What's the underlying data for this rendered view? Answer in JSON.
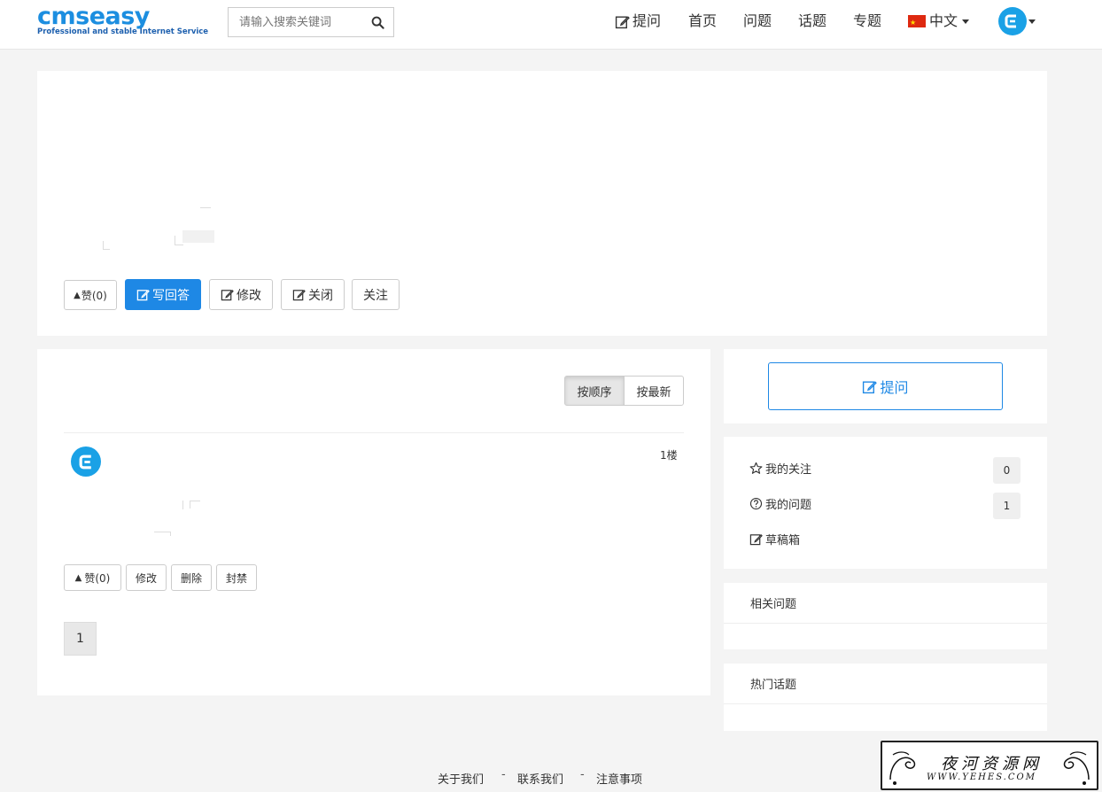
{
  "header": {
    "logo_text": "cmseasy",
    "logo_tagline": "Professional and stable Internet Service",
    "search_placeholder": "请输入搜索关键词",
    "nav": {
      "ask": "提问",
      "home": "首页",
      "questions": "问题",
      "topics": "话题",
      "specials": "专题",
      "language": "中文"
    }
  },
  "question": {
    "like_label": "赞(0)",
    "write_answer_label": "写回答",
    "edit_label": "修改",
    "close_label": "关闭",
    "follow_label": "关注"
  },
  "answers": {
    "sort_order_label": "按顺序",
    "sort_newest_label": "按最新",
    "floor_label": "1楼",
    "like_label": "赞(0)",
    "edit_label": "修改",
    "delete_label": "删除",
    "ban_label": "封禁",
    "page_number": "1"
  },
  "sidebar": {
    "ask_button_label": "提问",
    "my_follows_label": "我的关注",
    "my_follows_count": "0",
    "my_questions_label": "我的问题",
    "my_questions_count": "1",
    "drafts_label": "草稿箱",
    "related_title": "相关问题",
    "hot_topics_title": "热门话题"
  },
  "footer": {
    "about": "关于我们",
    "contact": "联系我们",
    "notice": "注意事项",
    "separator": "-"
  },
  "watermark": {
    "title": "夜河资源网",
    "url": "WWW.YEHES.COM"
  },
  "colors": {
    "primary": "#1e88e5",
    "logo_blue": "#1c8ee0",
    "avatar_blue": "#1aa1e6",
    "background": "#f4f4f4"
  }
}
